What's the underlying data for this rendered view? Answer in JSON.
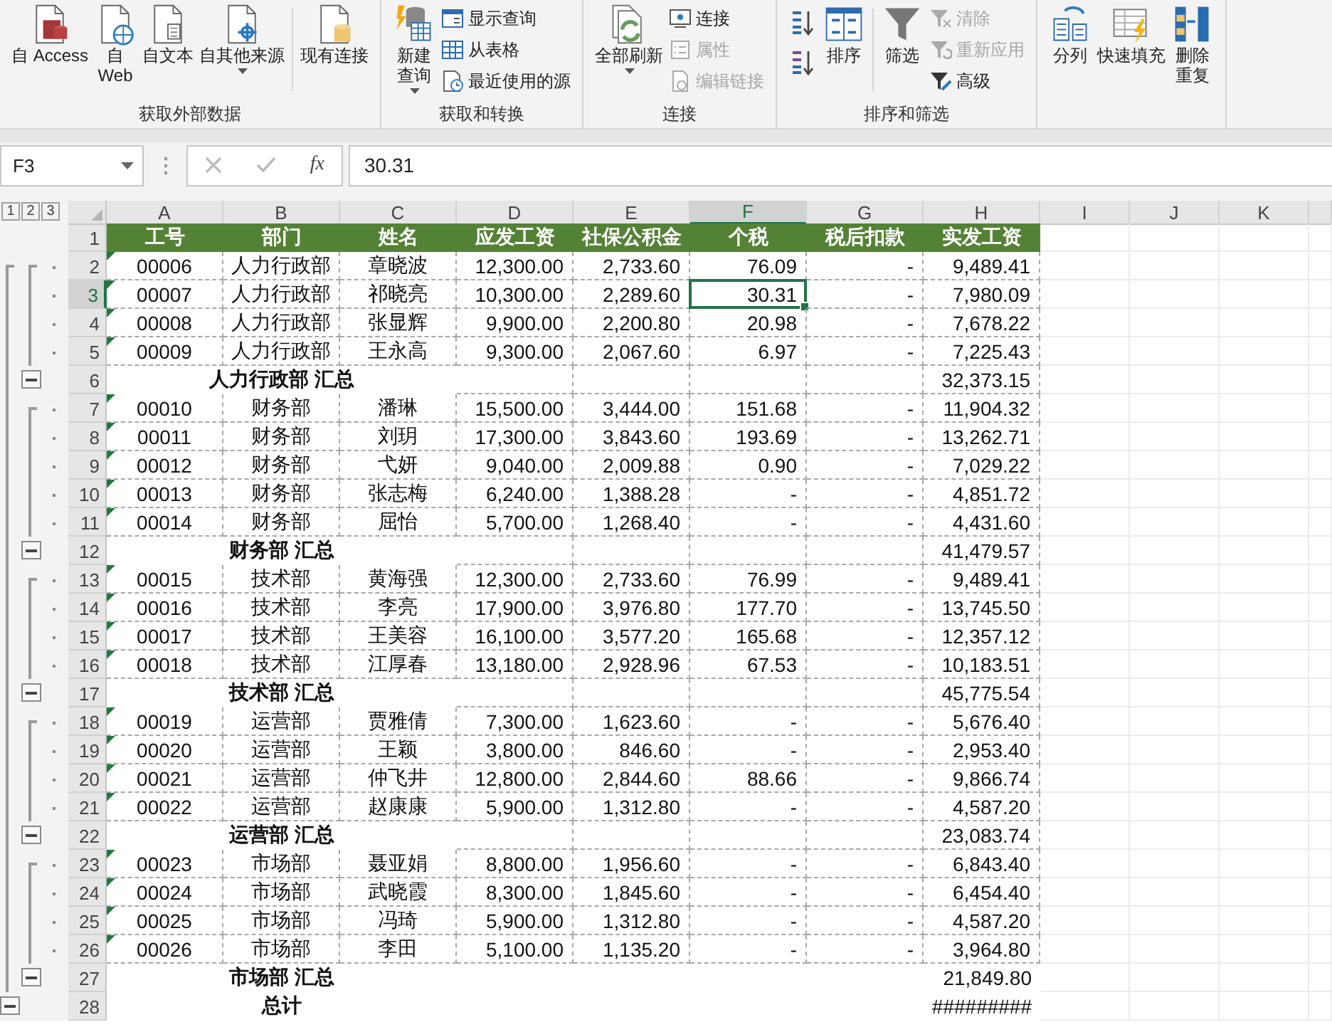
{
  "ribbon": {
    "groups": [
      {
        "label": "获取外部数据",
        "items": [
          {
            "kind": "large",
            "lines": [
              "自 Access"
            ]
          },
          {
            "kind": "large",
            "lines": [
              "自",
              "Web"
            ]
          },
          {
            "kind": "large",
            "lines": [
              "自文本"
            ]
          },
          {
            "kind": "large",
            "lines": [
              "自其他来源"
            ],
            "dropdown": true
          },
          {
            "kind": "separator"
          },
          {
            "kind": "large",
            "lines": [
              "现有连接"
            ]
          }
        ]
      },
      {
        "label": "获取和转换",
        "items": [
          {
            "kind": "large",
            "lines": [
              "新建",
              "查询"
            ],
            "dropdown": true
          },
          {
            "kind": "stack",
            "entries": [
              {
                "label": "显示查询",
                "disabled": false
              },
              {
                "label": "从表格",
                "disabled": false
              },
              {
                "label": "最近使用的源",
                "disabled": false
              }
            ]
          }
        ]
      },
      {
        "label": "连接",
        "items": [
          {
            "kind": "large",
            "lines": [
              "全部刷新"
            ],
            "dropdown": true
          },
          {
            "kind": "stack",
            "entries": [
              {
                "label": "连接",
                "disabled": false
              },
              {
                "label": "属性",
                "disabled": true
              },
              {
                "label": "编辑链接",
                "disabled": true
              }
            ]
          }
        ]
      },
      {
        "label": "排序和筛选",
        "items": [
          {
            "kind": "sortpair"
          },
          {
            "kind": "large",
            "lines": [
              "排序"
            ]
          },
          {
            "kind": "separator"
          },
          {
            "kind": "large",
            "lines": [
              "筛选"
            ]
          },
          {
            "kind": "stack",
            "entries": [
              {
                "label": "清除",
                "disabled": true
              },
              {
                "label": "重新应用",
                "disabled": true
              },
              {
                "label": "高级",
                "disabled": false
              }
            ]
          }
        ]
      },
      {
        "items": [
          {
            "kind": "large",
            "lines": [
              "分列"
            ]
          },
          {
            "kind": "large",
            "lines": [
              "快速填充"
            ]
          },
          {
            "kind": "large",
            "lines": [
              "删除",
              "重复"
            ]
          }
        ]
      }
    ]
  },
  "formula_bar": {
    "name_box": "F3",
    "insert_function": "fx",
    "value": "30.31"
  },
  "outline": {
    "levels": [
      "1",
      "2",
      "3"
    ]
  },
  "columns": [
    {
      "letter": "A",
      "selected": false
    },
    {
      "letter": "B",
      "selected": false
    },
    {
      "letter": "C",
      "selected": false
    },
    {
      "letter": "D",
      "selected": false
    },
    {
      "letter": "E",
      "selected": false
    },
    {
      "letter": "F",
      "selected": true
    },
    {
      "letter": "G",
      "selected": false
    },
    {
      "letter": "H",
      "selected": false
    },
    {
      "letter": "I",
      "selected": false
    },
    {
      "letter": "J",
      "selected": false
    },
    {
      "letter": "K",
      "selected": false
    }
  ],
  "rows": [
    {
      "number": "1",
      "kind": "header",
      "selected": false,
      "cells": [
        "工号",
        "部门",
        "姓名",
        "应发工资",
        "社保公积金",
        "个税",
        "税后扣款",
        "实发工资"
      ]
    },
    {
      "number": "2",
      "kind": "data",
      "selected": false,
      "cells": [
        "00006",
        "人力行政部",
        "章晓波",
        "12,300.00",
        "2,733.60",
        "76.09",
        "-",
        "9,489.41"
      ]
    },
    {
      "number": "3",
      "kind": "data",
      "selected": true,
      "cells": [
        "00007",
        "人力行政部",
        "祁晓亮",
        "10,300.00",
        "2,289.60",
        "30.31",
        "-",
        "7,980.09"
      ]
    },
    {
      "number": "4",
      "kind": "data",
      "selected": false,
      "cells": [
        "00008",
        "人力行政部",
        "张显辉",
        "9,900.00",
        "2,200.80",
        "20.98",
        "-",
        "7,678.22"
      ]
    },
    {
      "number": "5",
      "kind": "data",
      "selected": false,
      "cells": [
        "00009",
        "人力行政部",
        "王永高",
        "9,300.00",
        "2,067.60",
        "6.97",
        "-",
        "7,225.43"
      ]
    },
    {
      "number": "6",
      "kind": "subtotal",
      "selected": false,
      "label": "人力行政部 汇总",
      "total": "32,373.15"
    },
    {
      "number": "7",
      "kind": "data",
      "selected": false,
      "cells": [
        "00010",
        "财务部",
        "潘琳",
        "15,500.00",
        "3,444.00",
        "151.68",
        "-",
        "11,904.32"
      ]
    },
    {
      "number": "8",
      "kind": "data",
      "selected": false,
      "cells": [
        "00011",
        "财务部",
        "刘玥",
        "17,300.00",
        "3,843.60",
        "193.69",
        "-",
        "13,262.71"
      ]
    },
    {
      "number": "9",
      "kind": "data",
      "selected": false,
      "cells": [
        "00012",
        "财务部",
        "弋妍",
        "9,040.00",
        "2,009.88",
        "0.90",
        "-",
        "7,029.22"
      ]
    },
    {
      "number": "10",
      "kind": "data",
      "selected": false,
      "cells": [
        "00013",
        "财务部",
        "张志梅",
        "6,240.00",
        "1,388.28",
        "-",
        "-",
        "4,851.72"
      ]
    },
    {
      "number": "11",
      "kind": "data",
      "selected": false,
      "cells": [
        "00014",
        "财务部",
        "屈怡",
        "5,700.00",
        "1,268.40",
        "-",
        "-",
        "4,431.60"
      ]
    },
    {
      "number": "12",
      "kind": "subtotal",
      "selected": false,
      "label": "财务部 汇总",
      "total": "41,479.57"
    },
    {
      "number": "13",
      "kind": "data",
      "selected": false,
      "cells": [
        "00015",
        "技术部",
        "黄海强",
        "12,300.00",
        "2,733.60",
        "76.99",
        "-",
        "9,489.41"
      ]
    },
    {
      "number": "14",
      "kind": "data",
      "selected": false,
      "cells": [
        "00016",
        "技术部",
        "李亮",
        "17,900.00",
        "3,976.80",
        "177.70",
        "-",
        "13,745.50"
      ]
    },
    {
      "number": "15",
      "kind": "data",
      "selected": false,
      "cells": [
        "00017",
        "技术部",
        "王美容",
        "16,100.00",
        "3,577.20",
        "165.68",
        "-",
        "12,357.12"
      ]
    },
    {
      "number": "16",
      "kind": "data",
      "selected": false,
      "cells": [
        "00018",
        "技术部",
        "江厚春",
        "13,180.00",
        "2,928.96",
        "67.53",
        "-",
        "10,183.51"
      ]
    },
    {
      "number": "17",
      "kind": "subtotal",
      "selected": false,
      "label": "技术部 汇总",
      "total": "45,775.54"
    },
    {
      "number": "18",
      "kind": "data",
      "selected": false,
      "cells": [
        "00019",
        "运营部",
        "贾雅倩",
        "7,300.00",
        "1,623.60",
        "-",
        "-",
        "5,676.40"
      ]
    },
    {
      "number": "19",
      "kind": "data",
      "selected": false,
      "cells": [
        "00020",
        "运营部",
        "王颖",
        "3,800.00",
        "846.60",
        "-",
        "-",
        "2,953.40"
      ]
    },
    {
      "number": "20",
      "kind": "data",
      "selected": false,
      "cells": [
        "00021",
        "运营部",
        "仲飞井",
        "12,800.00",
        "2,844.60",
        "88.66",
        "-",
        "9,866.74"
      ]
    },
    {
      "number": "21",
      "kind": "data",
      "selected": false,
      "cells": [
        "00022",
        "运营部",
        "赵康康",
        "5,900.00",
        "1,312.80",
        "-",
        "-",
        "4,587.20"
      ]
    },
    {
      "number": "22",
      "kind": "subtotal",
      "selected": false,
      "label": "运营部 汇总",
      "total": "23,083.74"
    },
    {
      "number": "23",
      "kind": "data",
      "selected": false,
      "cells": [
        "00023",
        "市场部",
        "聂亚娟",
        "8,800.00",
        "1,956.60",
        "-",
        "-",
        "6,843.40"
      ]
    },
    {
      "number": "24",
      "kind": "data",
      "selected": false,
      "cells": [
        "00024",
        "市场部",
        "武晓霞",
        "8,300.00",
        "1,845.60",
        "-",
        "-",
        "6,454.40"
      ]
    },
    {
      "number": "25",
      "kind": "data",
      "selected": false,
      "cells": [
        "00025",
        "市场部",
        "冯琦",
        "5,900.00",
        "1,312.80",
        "-",
        "-",
        "4,587.20"
      ]
    },
    {
      "number": "26",
      "kind": "data",
      "selected": false,
      "cells": [
        "00026",
        "市场部",
        "李田",
        "5,100.00",
        "1,135.20",
        "-",
        "-",
        "3,964.80"
      ]
    },
    {
      "number": "27",
      "kind": "subtotal",
      "selected": false,
      "label": "市场部 汇总",
      "total": "21,849.80"
    },
    {
      "number": "28",
      "kind": "total",
      "selected": false,
      "label": "总计",
      "total": "#########"
    }
  ]
}
